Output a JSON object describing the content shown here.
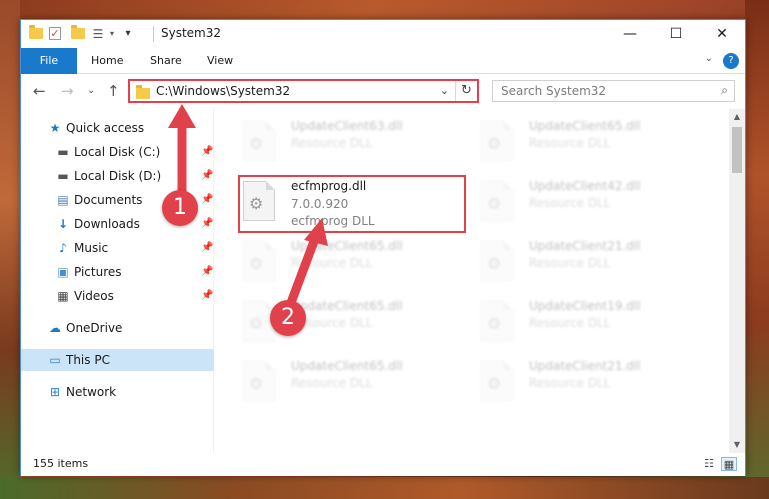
{
  "window": {
    "title": "System32",
    "controls": {
      "minimize": "—",
      "maximize": "☐",
      "close": "✕"
    }
  },
  "ribbon": {
    "file": "File",
    "tabs": [
      "Home",
      "Share",
      "View"
    ],
    "expand": "⌄",
    "help": "?"
  },
  "navbar": {
    "back": "←",
    "forward": "→",
    "recent": "⌄",
    "up": "↑",
    "address": "C:\\Windows\\System32",
    "address_dropdown": "⌄",
    "refresh": "↻",
    "search_placeholder": "Search System32",
    "search_icon": "⌕"
  },
  "sidebar": {
    "items": [
      {
        "label": "Quick access",
        "icon": "star-icon",
        "glyph": "★",
        "color": "#1979ca",
        "pinned": false
      },
      {
        "label": "Local Disk (C:)",
        "icon": "drive-icon",
        "glyph": "▬",
        "color": "#555555",
        "pinned": true
      },
      {
        "label": "Local Disk (D:)",
        "icon": "drive-icon",
        "glyph": "▬",
        "color": "#555555",
        "pinned": true
      },
      {
        "label": "Documents",
        "icon": "documents-icon",
        "glyph": "▤",
        "color": "#4a78b0",
        "pinned": true
      },
      {
        "label": "Downloads",
        "icon": "downloads-icon",
        "glyph": "↓",
        "color": "#1979ca",
        "pinned": true
      },
      {
        "label": "Music",
        "icon": "music-icon",
        "glyph": "♪",
        "color": "#1979ca",
        "pinned": true
      },
      {
        "label": "Pictures",
        "icon": "pictures-icon",
        "glyph": "▣",
        "color": "#4a8fc7",
        "pinned": true
      },
      {
        "label": "Videos",
        "icon": "videos-icon",
        "glyph": "▦",
        "color": "#444444",
        "pinned": true
      },
      {
        "label": "OneDrive",
        "icon": "cloud-icon",
        "glyph": "☁",
        "color": "#1979ca",
        "pinned": false
      },
      {
        "label": "This PC",
        "icon": "computer-icon",
        "glyph": "▭",
        "color": "#2f7fc8",
        "pinned": false
      },
      {
        "label": "Network",
        "icon": "network-icon",
        "glyph": "⊞",
        "color": "#2f7fc8",
        "pinned": false
      }
    ],
    "pin_glyph": "📌"
  },
  "files": {
    "highlighted": {
      "name": "ecfmprog.dll",
      "version": "7.0.0.920",
      "description": "ecfmprog DLL"
    },
    "blurred": [
      {
        "name": "UpdateClient63.dll",
        "type": "Resource DLL"
      },
      {
        "name": "UpdateClient65.dll",
        "type": "Resource DLL"
      },
      {
        "name": "UpdateClient42.dll",
        "type": "Resource DLL"
      },
      {
        "name": "UpdateClient65.dll",
        "type": "Resource DLL"
      },
      {
        "name": "UpdateClient21.dll",
        "type": "Resource DLL"
      },
      {
        "name": "UpdateClient65.dll",
        "type": "Resource DLL"
      },
      {
        "name": "UpdateClient19.dll",
        "type": "Resource DLL"
      },
      {
        "name": "UpdateClient65.dll",
        "type": "Resource DLL"
      },
      {
        "name": "UpdateClient21.dll",
        "type": "Resource DLL"
      }
    ]
  },
  "status": {
    "items": "155 items"
  },
  "callouts": [
    "1",
    "2"
  ],
  "colors": {
    "accent": "#1979ca",
    "annotation": "#e0414a"
  }
}
